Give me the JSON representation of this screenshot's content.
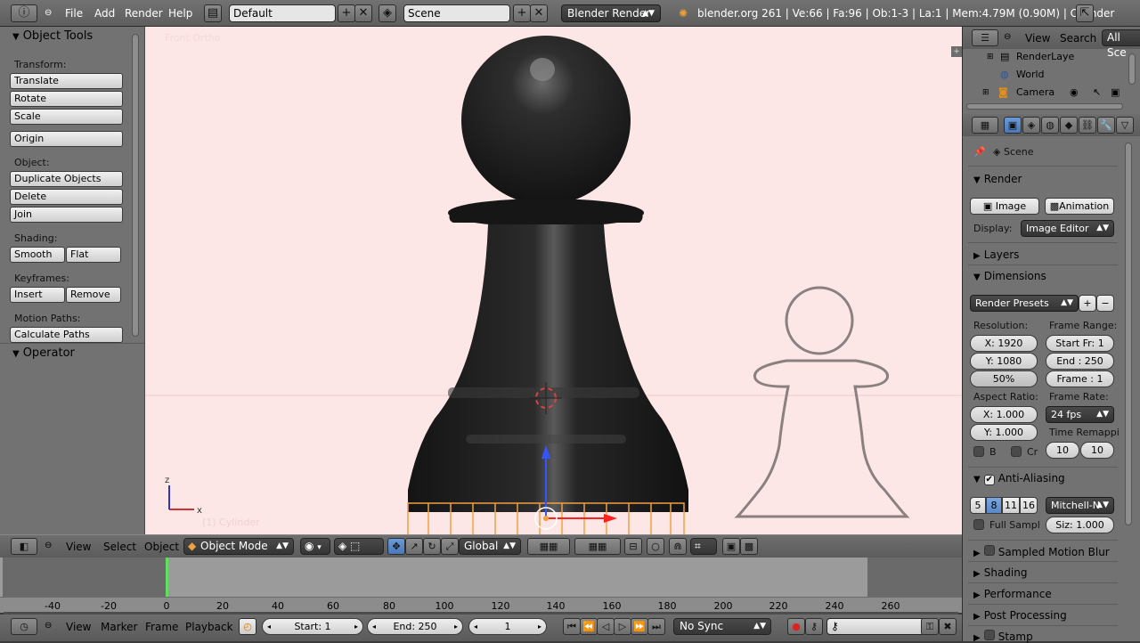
{
  "topbar": {
    "menus": [
      "File",
      "Add",
      "Render",
      "Help"
    ],
    "layout": "Default",
    "scene": "Scene",
    "engine": "Blender Render",
    "info": "blender.org 261 | Ve:66 | Fa:96 | Ob:1-3 | La:1 | Mem:4.79M (0.90M) | Cylinder"
  },
  "toolshelf": {
    "title": "Object Tools",
    "transform_label": "Transform:",
    "translate": "Translate",
    "rotate": "Rotate",
    "scale": "Scale",
    "origin": "Origin",
    "object_label": "Object:",
    "duplicate": "Duplicate Objects",
    "delete": "Delete",
    "join": "Join",
    "shading_label": "Shading:",
    "smooth": "Smooth",
    "flat": "Flat",
    "keyframes_label": "Keyframes:",
    "insert": "Insert",
    "remove": "Remove",
    "motion_label": "Motion Paths:",
    "calc_paths": "Calculate Paths",
    "operator": "Operator"
  },
  "viewport": {
    "view_label": "Front Ortho",
    "object_label": "(1) Cylinder"
  },
  "vp_header": {
    "view": "View",
    "select": "Select",
    "object": "Object",
    "mode": "Object Mode",
    "orientation": "Global"
  },
  "timeline": {
    "ticks": [
      "-40",
      "-20",
      "0",
      "20",
      "40",
      "60",
      "80",
      "100",
      "120",
      "140",
      "160",
      "180",
      "200",
      "220",
      "240",
      "260"
    ],
    "view": "View",
    "marker": "Marker",
    "frame": "Frame",
    "playback": "Playback",
    "start": "Start: 1",
    "end": "End: 250",
    "current": "1",
    "sync": "No Sync"
  },
  "outliner": {
    "view": "View",
    "search": "Search",
    "filter": "All Sce",
    "items": [
      "RenderLaye",
      "World",
      "Camera"
    ]
  },
  "props": {
    "context": "Scene",
    "render_title": "Render",
    "image_btn": "Image",
    "animation_btn": "Animation",
    "display_label": "Display:",
    "display_value": "Image Editor",
    "layers_title": "Layers",
    "dimensions_title": "Dimensions",
    "presets": "Render Presets",
    "resolution_label": "Resolution:",
    "res_x": "X: 1920",
    "res_y": "Y: 1080",
    "res_pct": "50%",
    "frame_range_label": "Frame Range:",
    "start_fr": "Start Fr: 1",
    "end_fr": "End : 250",
    "frame": "Frame : 1",
    "aspect_label": "Aspect Ratio:",
    "asp_x": "X: 1.000",
    "asp_y": "Y: 1.000",
    "frame_rate_label": "Frame Rate:",
    "fps": "24 fps",
    "border": "B",
    "crop": "Cr",
    "time_remap_label": "Time Remappi",
    "remap_old": "10",
    "remap_new": "10",
    "aa_title": "Anti-Aliasing",
    "aa_samples": [
      "5",
      "8",
      "11",
      "16"
    ],
    "aa_filter": "Mitchell-N",
    "full_sample": "Full Sampl",
    "aa_size": "Siz: 1.000",
    "motion_blur_title": "Sampled Motion Blur",
    "shading_title": "Shading",
    "performance_title": "Performance",
    "post_title": "Post Processing",
    "stamp_title": "Stamp"
  }
}
